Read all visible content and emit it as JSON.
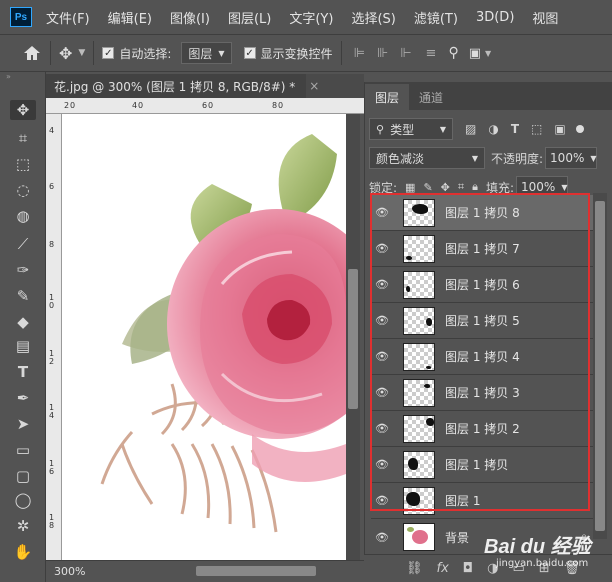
{
  "app": {
    "logo": "Ps",
    "menu": [
      "文件(F)",
      "编辑(E)",
      "图像(I)",
      "图层(L)",
      "文字(Y)",
      "选择(S)",
      "滤镜(T)",
      "3D(D)",
      "视图"
    ]
  },
  "options": {
    "auto_select_label": "自动选择:",
    "auto_select_value": "图层",
    "show_transform_label": "显示变换控件"
  },
  "document": {
    "tab_title": "花.jpg @ 300% (图层 1 拷贝 8, RGB/8#) *",
    "close_glyph": "×",
    "zoom": "300%",
    "ruler_h": [
      "2",
      "0",
      "4",
      "0",
      "6",
      "0",
      "8",
      "0"
    ],
    "ruler_v": [
      "4",
      "6",
      "8",
      "1 0",
      "1 2",
      "1 4",
      "1 6",
      "1 8"
    ]
  },
  "layers_panel": {
    "tabs": [
      "图层",
      "通道"
    ],
    "filter_label": "类型",
    "blend_mode": "颜色减淡",
    "opacity_label": "不透明度:",
    "opacity_value": "100%",
    "lock_label": "锁定:",
    "fill_label": "填充:",
    "fill_value": "100%",
    "layers": [
      {
        "name": "图层 1 拷贝 8",
        "selected": true
      },
      {
        "name": "图层 1 拷贝 7",
        "selected": false
      },
      {
        "name": "图层 1 拷贝 6",
        "selected": false
      },
      {
        "name": "图层 1 拷贝 5",
        "selected": false
      },
      {
        "name": "图层 1 拷贝 4",
        "selected": false
      },
      {
        "name": "图层 1 拷贝 3",
        "selected": false
      },
      {
        "name": "图层 1 拷贝 2",
        "selected": false
      },
      {
        "name": "图层 1 拷贝",
        "selected": false
      },
      {
        "name": "图层 1",
        "selected": false
      },
      {
        "name": "背景",
        "selected": false
      }
    ],
    "bottom_icons": [
      "link-icon",
      "fx-icon",
      "mask-icon",
      "adjustment-icon",
      "folder-icon",
      "new-layer-icon",
      "trash-icon"
    ],
    "fx_label": "fx"
  },
  "watermark": {
    "main": "Bai du 经验",
    "sub": "jingyan.baidu.com"
  },
  "colors": {
    "highlight": "#e03030",
    "accent": "#31a8ff"
  }
}
